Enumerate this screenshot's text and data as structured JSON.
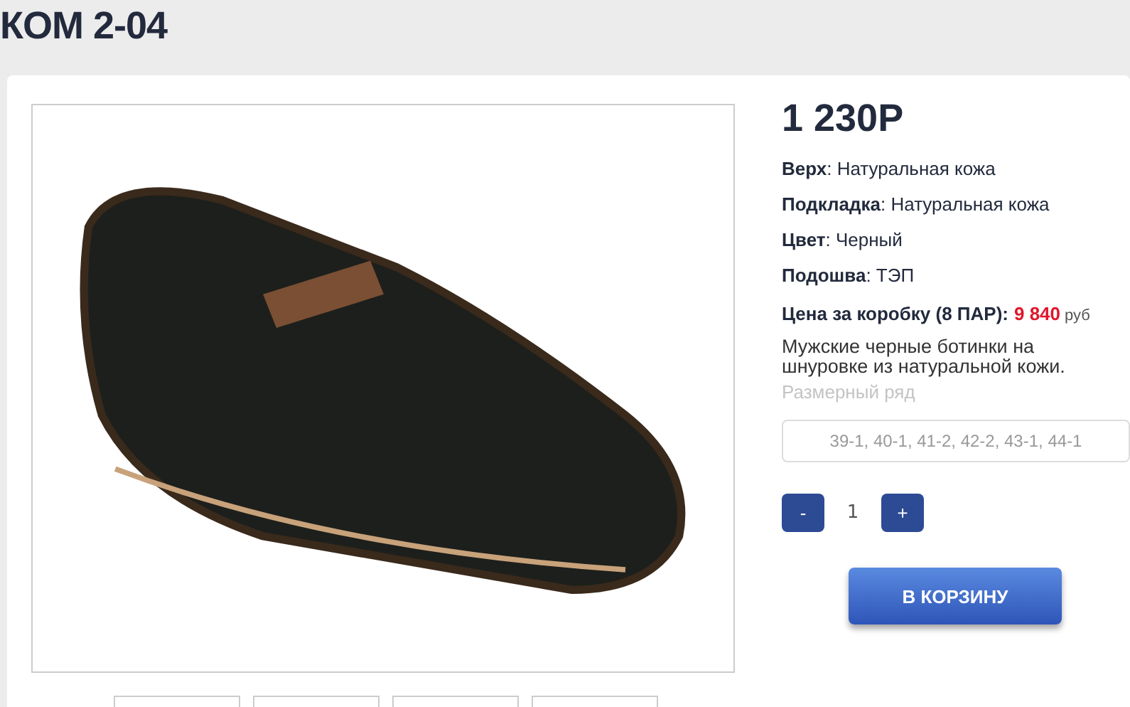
{
  "title": "КОМ 2-04",
  "price": "1 230Р",
  "specs": [
    "**Верх**: Натуральная кожа",
    "**Подкладка**: Натуральная кожа",
    "**Цвет**: Черный",
    "**Подошва**: ТЭП"
  ],
  "box_price": {
    "label": "Цена за коробку (8 ПАР):",
    "value": "9 840",
    "unit": "руб"
  },
  "description": "Мужские черные ботинки на шнуровке из натуральной кожи.",
  "sizes": {
    "label": "Размерный ряд",
    "placeholder": "39-1, 40-1, 41-2, 42-2, 43-1, 44-1"
  },
  "quantity": {
    "minus": "-",
    "value": "1",
    "plus": "+"
  },
  "cart_button": "В КОРЗИНУ"
}
